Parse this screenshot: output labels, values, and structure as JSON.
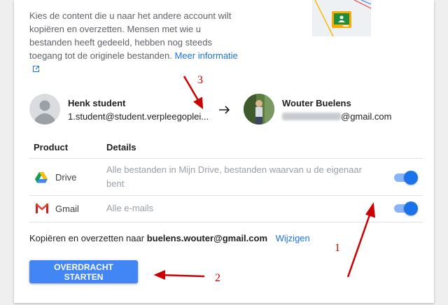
{
  "intro": {
    "text": "Kies de content die u naar het andere account wilt kopiëren en overzetten. Mensen met wie u bestanden heeft gedeeld, hebben nog steeds toegang tot de originele bestanden.",
    "link": "Meer informatie"
  },
  "source_account": {
    "name": "Henk student",
    "email": "1.student@student.verpleegoplei..."
  },
  "target_account": {
    "name": "Wouter Buelens",
    "email_visible": "@gmail.com"
  },
  "table": {
    "headers": [
      "Product",
      "Details"
    ],
    "rows": [
      {
        "product": "Drive",
        "details": "Alle bestanden in Mijn Drive, bestanden waarvan u de eigenaar bent",
        "icon": "google-drive-icon",
        "enabled": true
      },
      {
        "product": "Gmail",
        "details": "Alle e-mails",
        "icon": "gmail-icon",
        "enabled": true
      }
    ]
  },
  "copy_to": {
    "prefix": "Kopiëren en overzetten naar",
    "email": "buelens.wouter@gmail.com",
    "change_link": "Wijzigen"
  },
  "start_button": "OVERDRACHT STARTEN",
  "annotations": [
    "1",
    "2",
    "3"
  ],
  "colors": {
    "accent": "#1a73e8",
    "button": "#4285f4",
    "toggle_track": "#8ab4f8",
    "annotation": "#cc0000"
  }
}
